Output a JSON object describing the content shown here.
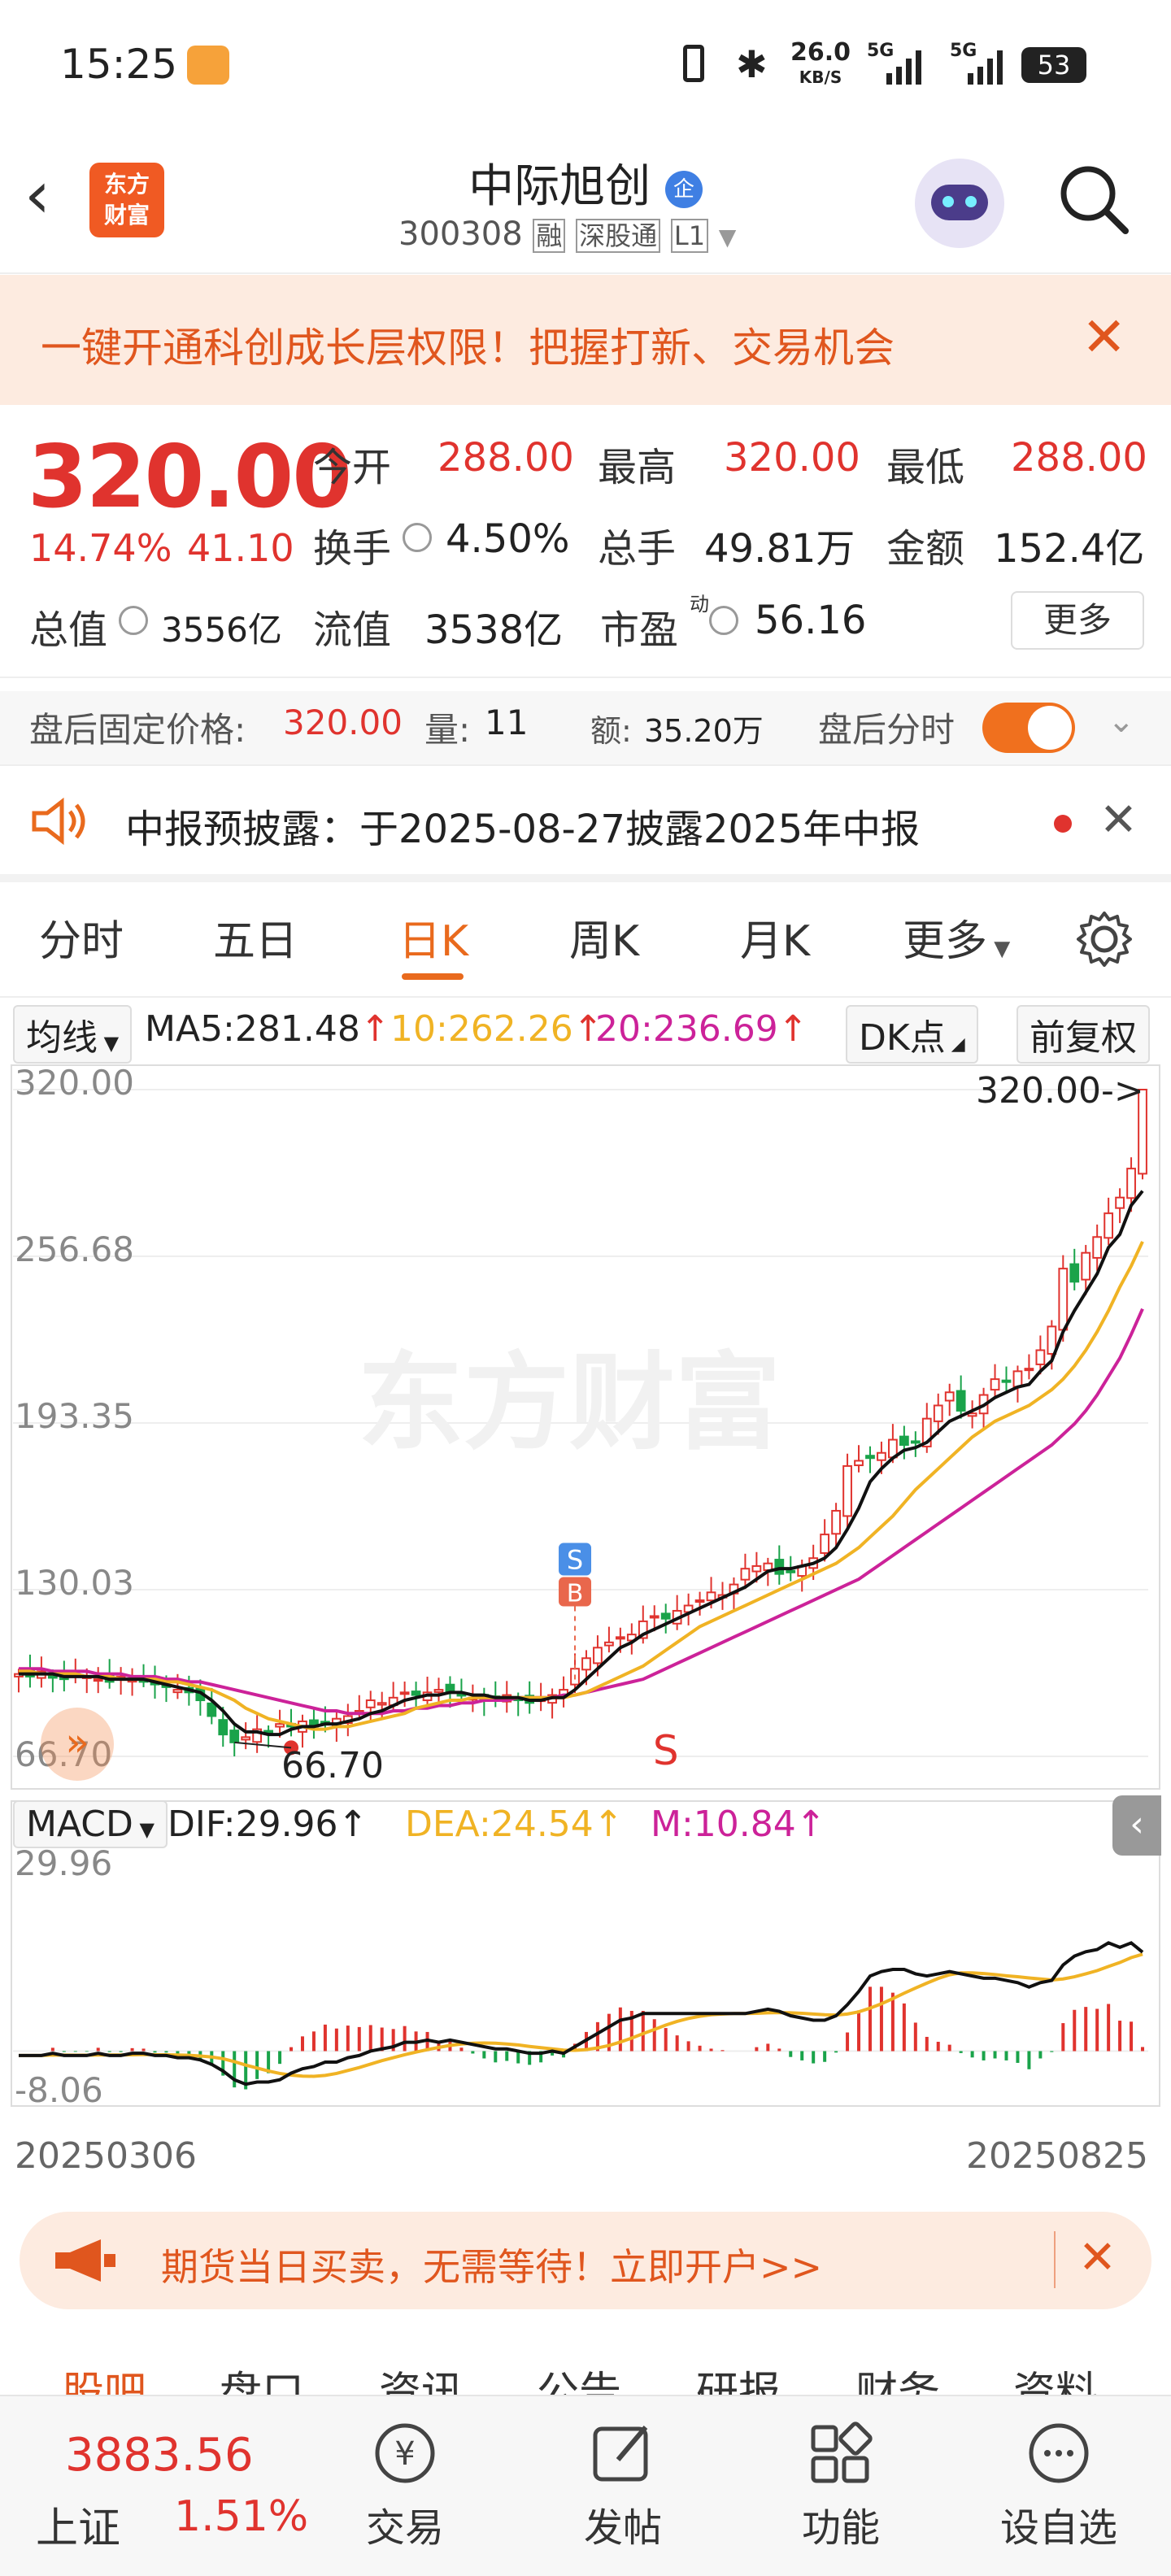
{
  "status_bar": {
    "time": "15:25",
    "net_speed": "26.0",
    "net_unit": "KB/S",
    "sig1": "5G",
    "sig2": "5G",
    "battery": "53"
  },
  "header": {
    "stock_name": "中际旭创",
    "name_badge": "企",
    "code": "300308",
    "tags": [
      "融",
      "深股通",
      "L1"
    ],
    "logo_text_1": "东方",
    "logo_text_2": "财富"
  },
  "promo_banner": {
    "text": "一键开通科创成长层权限！把握打新、交易机会"
  },
  "quote": {
    "price": "320.00",
    "change_pct": "14.74%",
    "change_amt": "41.10",
    "open_label": "今开",
    "open": "288.00",
    "high_label": "最高",
    "high": "320.00",
    "low_label": "最低",
    "low": "288.00",
    "turnover_label": "换手",
    "turnover": "4.50%",
    "volume_label": "总手",
    "volume": "49.81万",
    "amount_label": "金额",
    "amount": "152.4亿",
    "mktcap_label": "总值",
    "mktcap": "3556亿",
    "float_label": "流值",
    "float_cap": "3538亿",
    "pe_label": "市盈",
    "pe_sup": "动",
    "pe": "56.16",
    "more_button": "更多"
  },
  "after_hours": {
    "label": "盘后固定价格:",
    "price": "320.00",
    "vol_label": "量:",
    "vol": "11",
    "amt_label": "额:",
    "amt": "35.20万",
    "toggle_label": "盘后分时"
  },
  "notice": {
    "text": "中报预披露：于2025-08-27披露2025年中报"
  },
  "tabs": [
    "分时",
    "五日",
    "日K",
    "周K",
    "月K",
    "更多"
  ],
  "active_tab": "日K",
  "ma_row": {
    "selector": "均线",
    "ma5": "MA5:281.48",
    "ma10": "10:262.26",
    "ma20": "20:236.69",
    "dk_button": "DK点",
    "adjust_button": "前复权"
  },
  "colors": {
    "up": "#e0332e",
    "down": "#1aa34a",
    "ma5": "#111111",
    "ma10": "#f0b324",
    "ma20": "#cc2299",
    "accent": "#e96a1d"
  },
  "chart_data": {
    "type": "candlestick",
    "y_ticks": [
      "320.00",
      "256.68",
      "193.35",
      "130.03",
      "66.70"
    ],
    "ylim": [
      66.7,
      320.0
    ],
    "x_start": "20250306",
    "x_end": "20250825",
    "max_label": "320.00->",
    "min_label": "66.70",
    "signal_marks": [
      "S",
      "B",
      "S"
    ],
    "watermark": "东方财富",
    "close": [
      98,
      97,
      99,
      97,
      96,
      98,
      97,
      96,
      95,
      97,
      96,
      95,
      94,
      93,
      92,
      91,
      88,
      82,
      75,
      72,
      74,
      77,
      76,
      79,
      78,
      80,
      78,
      79,
      81,
      82,
      84,
      88,
      87,
      89,
      91,
      90,
      91,
      92,
      91,
      90,
      89,
      88,
      89,
      90,
      88,
      87,
      89,
      90,
      92,
      100,
      104,
      108,
      110,
      112,
      113,
      118,
      120,
      119,
      122,
      124,
      126,
      129,
      128,
      132,
      138,
      139,
      140,
      136,
      137,
      139,
      142,
      151,
      160,
      177,
      179,
      180,
      182,
      187,
      185,
      186,
      195,
      200,
      205,
      198,
      197,
      204,
      210,
      209,
      213,
      214,
      221,
      230,
      252,
      247,
      258,
      264,
      273,
      279,
      290,
      320
    ],
    "ma5": [
      98,
      98,
      98,
      98,
      97,
      97,
      97,
      97,
      96,
      96,
      96,
      96,
      95,
      94,
      93,
      92,
      91,
      88,
      84,
      79,
      76,
      76,
      75,
      75,
      77,
      78,
      78,
      79,
      79,
      80,
      81,
      83,
      84,
      86,
      88,
      89,
      90,
      90,
      91,
      91,
      90,
      90,
      89,
      89,
      89,
      88,
      88,
      89,
      89,
      92,
      96,
      100,
      104,
      108,
      110,
      113,
      115,
      117,
      119,
      121,
      123,
      125,
      127,
      129,
      131,
      134,
      137,
      138,
      138,
      139,
      140,
      142,
      146,
      153,
      161,
      171,
      176,
      180,
      183,
      184,
      186,
      190,
      194,
      196,
      198,
      200,
      203,
      205,
      207,
      208,
      213,
      217,
      228,
      236,
      243,
      250,
      260,
      265,
      276,
      281.48
    ],
    "ma10": [
      99,
      99,
      98,
      98,
      98,
      98,
      97,
      97,
      97,
      96,
      96,
      96,
      96,
      95,
      95,
      94,
      93,
      92,
      90,
      88,
      85,
      83,
      81,
      80,
      79,
      78,
      77,
      77,
      78,
      78,
      79,
      80,
      81,
      82,
      83,
      85,
      86,
      87,
      88,
      88,
      89,
      89,
      89,
      89,
      89,
      89,
      89,
      89,
      89,
      90,
      91,
      93,
      95,
      97,
      99,
      101,
      104,
      107,
      110,
      113,
      116,
      118,
      120,
      122,
      124,
      126,
      128,
      130,
      132,
      134,
      136,
      138,
      140,
      143,
      146,
      150,
      154,
      158,
      163,
      168,
      172,
      176,
      180,
      184,
      188,
      191,
      194,
      196,
      198,
      200,
      203,
      206,
      210,
      215,
      221,
      228,
      236,
      245,
      253,
      262.26
    ],
    "ma20": [
      100,
      100,
      100,
      99,
      99,
      99,
      99,
      98,
      98,
      98,
      97,
      97,
      97,
      96,
      96,
      95,
      95,
      94,
      93,
      92,
      91,
      90,
      89,
      88,
      87,
      86,
      85,
      84,
      84,
      83,
      83,
      83,
      83,
      84,
      84,
      85,
      85,
      86,
      86,
      87,
      87,
      88,
      88,
      88,
      89,
      89,
      89,
      89,
      90,
      90,
      91,
      92,
      93,
      94,
      95,
      96,
      98,
      100,
      102,
      104,
      106,
      108,
      110,
      112,
      114,
      116,
      118,
      120,
      122,
      124,
      126,
      128,
      130,
      132,
      134,
      137,
      140,
      143,
      146,
      149,
      152,
      155,
      158,
      161,
      164,
      167,
      170,
      173,
      176,
      179,
      182,
      185,
      189,
      193,
      198,
      204,
      211,
      218,
      227,
      236.69
    ],
    "macd": {
      "label": "MACD",
      "dif": "DIF:29.96",
      "dea": "DEA:24.54",
      "m": "M:10.84",
      "y_ticks": [
        "29.96",
        "-8.06"
      ],
      "ylim": [
        -8.06,
        29.96
      ]
    }
  },
  "ad": {
    "text": "期货当日买卖，无需等待！立即开户>>"
  },
  "subtabs": [
    "股吧",
    "盘口",
    "资讯",
    "公告",
    "研报",
    "财务",
    "资料"
  ],
  "index_ticker": {
    "value": "3883.56",
    "name": "上证",
    "change": "1.51%"
  },
  "bottom_nav": {
    "trade": "交易",
    "post": "发帖",
    "func": "功能",
    "watch": "设自选",
    "trade_icon": "yen-circle-icon",
    "post_icon": "edit-icon",
    "func_icon": "grid-icon",
    "watch_icon": "more-circle-icon"
  }
}
